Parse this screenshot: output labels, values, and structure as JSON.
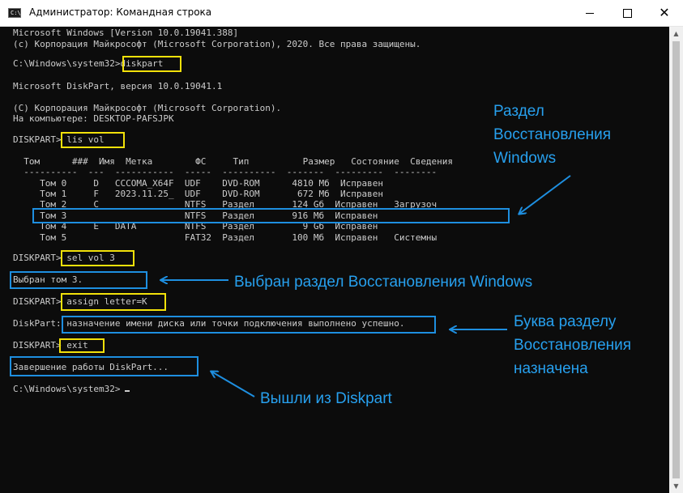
{
  "window": {
    "title": "Администратор: Командная строка",
    "icon": "cmd-icon",
    "buttons": {
      "minimize": "minimize-icon",
      "maximize": "maximize-icon",
      "close": "close-icon"
    }
  },
  "console": {
    "lines": [
      "Microsoft Windows [Version 10.0.19041.388]",
      "(c) Корпорация Майкрософт (Microsoft Corporation), 2020. Все права защищены.",
      "",
      "C:\\Windows\\system32>diskpart",
      "",
      "Microsoft DiskPart, версия 10.0.19041.1",
      "",
      "(C) Корпорация Майкрософт (Microsoft Corporation).",
      "На компьютере: DESKTOP-PAFSJPK",
      "",
      "DISKPART> lis vol",
      "",
      "  Том      ###  Имя  Метка        ФС     Тип          Размер   Состояние  Сведения",
      "  ----------  ---  -----------  -----  ----------  -------  ---------  --------",
      "     Том 0     D   CCCOMA_X64F  UDF    DVD-ROM      4810 Мб  Исправен",
      "     Том 1     F   2023.11.25_  UDF    DVD-ROM       672 Мб  Исправен",
      "     Том 2     C                NTFS   Раздел       124 Gб  Исправен   Загрузоч",
      "     Том 3                      NTFS   Раздел       916 Мб  Исправен",
      "     Том 4     E   DATA         NTFS   Раздел         9 Gб  Исправен",
      "     Том 5                      FAT32  Раздел       100 Мб  Исправен   Системны",
      "",
      "DISKPART> sel vol 3",
      "",
      "Выбран том 3.",
      "",
      "DISKPART> assign letter=K",
      "",
      "DiskPart: назначение имени диска или точки подключения выполнено успешно.",
      "",
      "DISKPART> exit",
      "",
      "Завершение работы DiskPart...",
      "",
      "C:\\Windows\\system32>"
    ]
  },
  "annotations": {
    "recovery_partition": "Раздел\nВосстановления\nWindows",
    "selected": "Выбран раздел Восстановления Windows",
    "letter_assigned": "Буква разделу\nВосстановления\nназначена",
    "exited": "Вышли из Diskpart"
  },
  "colors": {
    "console_bg": "#0c0c0c",
    "console_text": "#cccccc",
    "highlight_yellow": "#f2e10a",
    "highlight_blue": "#1e8fe0",
    "annotation_text": "#27a0ee"
  }
}
